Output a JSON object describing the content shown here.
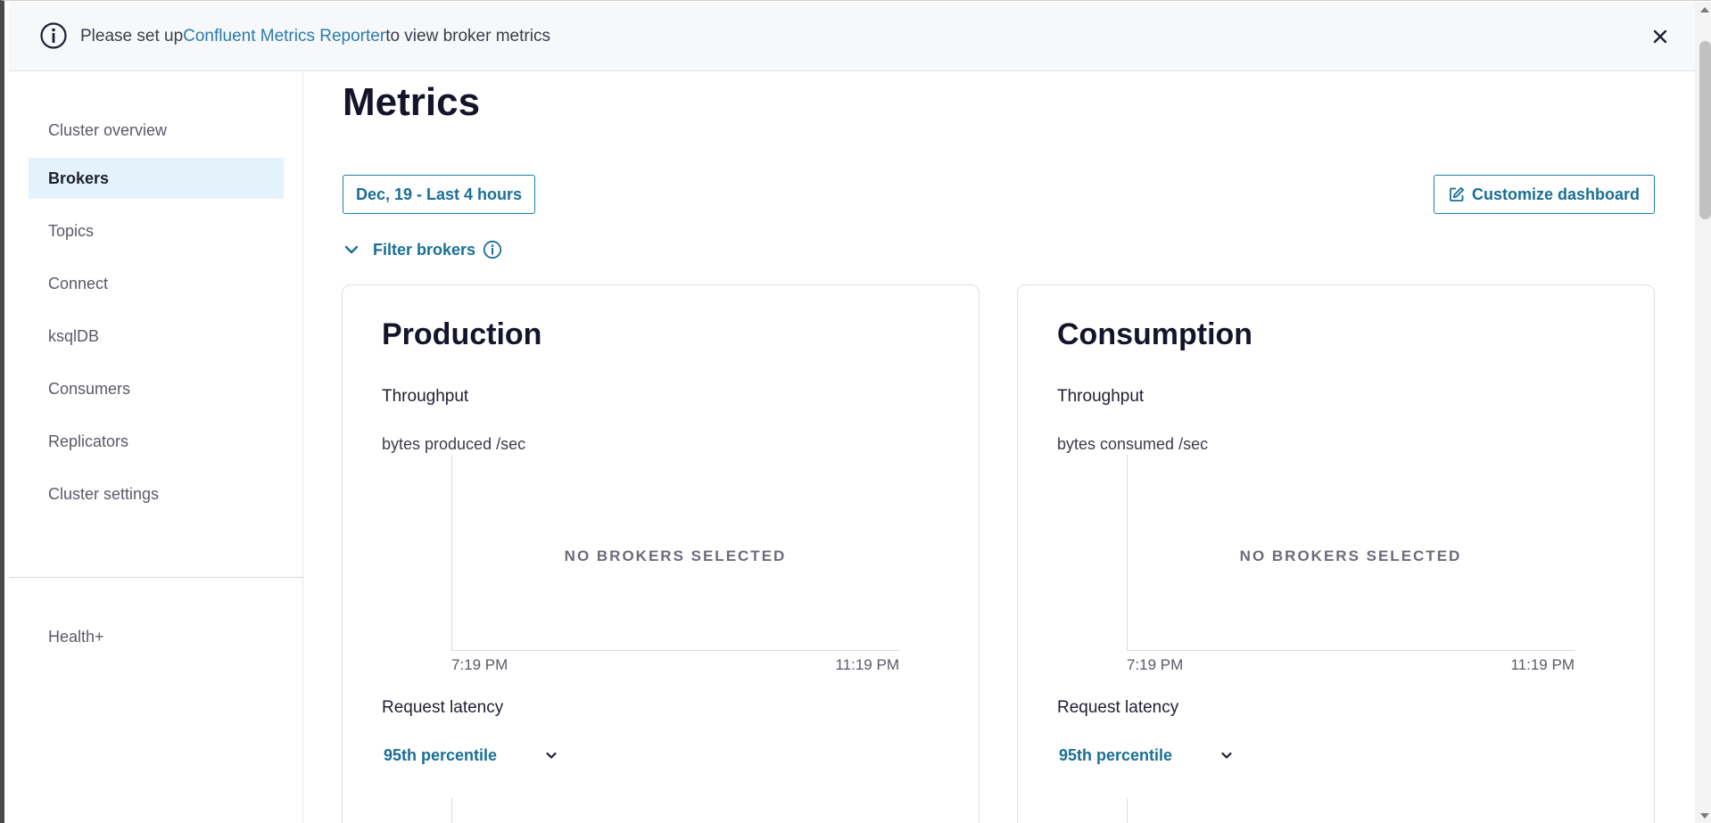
{
  "banner": {
    "prefix": "Please set up",
    "link": "Confluent Metrics Reporter",
    "suffix": "to view broker metrics",
    "icon": "info-icon",
    "close_icon": "close-icon"
  },
  "sidebar": {
    "items": [
      {
        "label": "Cluster overview",
        "active": false
      },
      {
        "label": "Brokers",
        "active": true
      },
      {
        "label": "Topics",
        "active": false
      },
      {
        "label": "Connect",
        "active": false
      },
      {
        "label": "ksqlDB",
        "active": false
      },
      {
        "label": "Consumers",
        "active": false
      },
      {
        "label": "Replicators",
        "active": false
      },
      {
        "label": "Cluster settings",
        "active": false
      }
    ],
    "footer_item": "Health+"
  },
  "main": {
    "title": "Metrics",
    "date_range": "Dec, 19 - Last 4 hours",
    "customize_label": "Customize dashboard",
    "filter_label": "Filter brokers",
    "cards": [
      {
        "title": "Production",
        "throughput_label": "Throughput",
        "metric_label": "bytes produced /sec",
        "empty_text": "NO BROKERS SELECTED",
        "x_start": "7:19 PM",
        "x_end": "11:19 PM",
        "latency_label": "Request latency",
        "percentile": "95th percentile"
      },
      {
        "title": "Consumption",
        "throughput_label": "Throughput",
        "metric_label": "bytes consumed /sec",
        "empty_text": "NO BROKERS SELECTED",
        "x_start": "7:19 PM",
        "x_end": "11:19 PM",
        "latency_label": "Request latency",
        "percentile": "95th percentile"
      }
    ]
  },
  "colors": {
    "accent": "#1a6f95",
    "link": "#2b7bb0",
    "active_nav_bg": "#e4f3fb"
  }
}
